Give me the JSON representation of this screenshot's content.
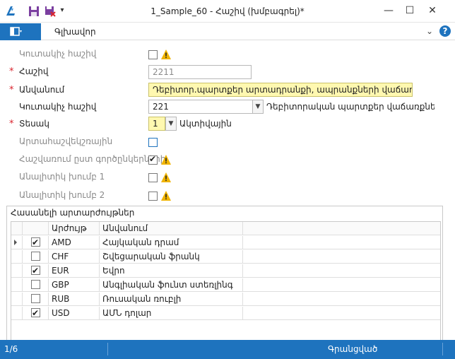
{
  "window": {
    "title": "1_Sample_60 - Հաշիվ (խմբագրել)*",
    "minimize": "—",
    "maximize": "☐",
    "close": "✕"
  },
  "ribbon": {
    "tab_main": "Գլխավոր",
    "collapse": "⌄",
    "help": "?"
  },
  "form": {
    "fields": [
      {
        "label": "Կուտակիչ հաշիվ",
        "dim": true
      },
      {
        "label": "Հաշիվ",
        "required": true,
        "value": "2211"
      },
      {
        "label": "Անվանում",
        "required": true,
        "value": "Դեբիտոր.պարտքեր արտադրանքի, ապրանքների վաճառքի գծ."
      },
      {
        "label": "Կուտակիչ հաշիվ",
        "value": "221",
        "description": "Դեբիտորական պարտքեր վաճառքների գծ"
      },
      {
        "label": "Տեսակ",
        "required": true,
        "value": "1",
        "description": "Ակտիվային"
      },
      {
        "label": "Արտահաշվեկշռային",
        "dim": true
      },
      {
        "label": "Հաշվառում ըստ գործընկերների",
        "dim": true,
        "checked": true
      },
      {
        "label": "Անալիտիկ խումբ 1",
        "dim": true
      },
      {
        "label": "Անալիտիկ խումբ 2",
        "dim": true
      }
    ]
  },
  "grid": {
    "title": "Հասանելի արտարժույթներ",
    "columns": {
      "code": "Արժույթ",
      "name": "Անվանում"
    },
    "rows": [
      {
        "checked": true,
        "code": "AMD",
        "name": "Հայկական դրամ"
      },
      {
        "checked": false,
        "code": "CHF",
        "name": "Շվեցարական ֆրանկ"
      },
      {
        "checked": true,
        "code": "EUR",
        "name": "Եվրո"
      },
      {
        "checked": false,
        "code": "GBP",
        "name": "Անգլիական ֆունտ ստեռլինգ"
      },
      {
        "checked": false,
        "code": "RUB",
        "name": "Ռուսական ռուբլի"
      },
      {
        "checked": true,
        "code": "USD",
        "name": "ԱՄՆ դոլար"
      }
    ]
  },
  "status": {
    "record": "1/6",
    "state": "Գրանցված"
  },
  "colors": {
    "accent": "#1e73be",
    "required": "#d9232d",
    "highlight": "#fff8b0"
  }
}
